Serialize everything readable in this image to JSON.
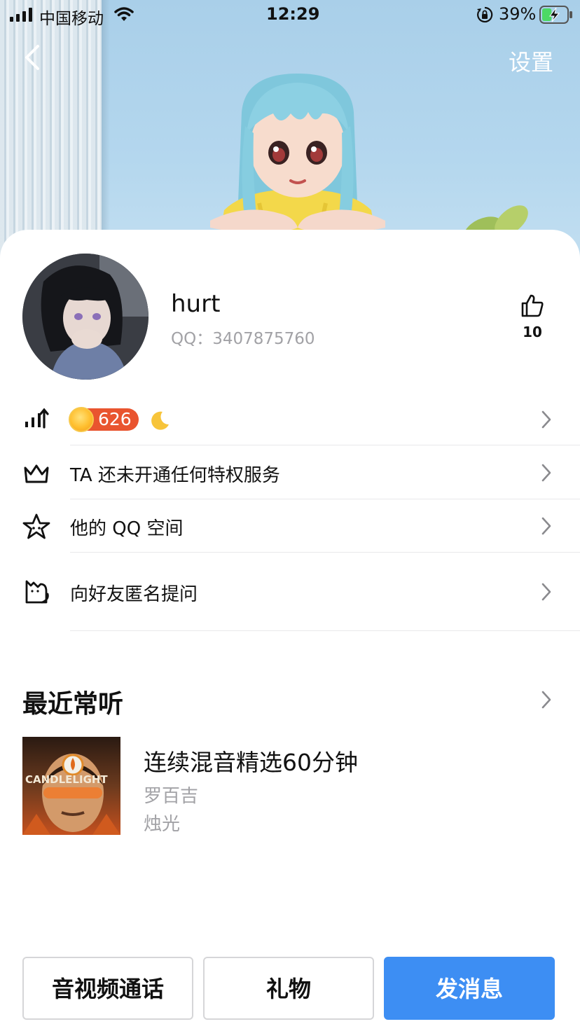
{
  "status_bar": {
    "carrier": "中国移动",
    "time": "12:29",
    "battery_percent": "39%",
    "battery_level": 0.39,
    "icons": [
      "signal-icon",
      "wifi-icon",
      "orientation-lock-icon",
      "battery-charging-icon"
    ]
  },
  "nav": {
    "back_icon": "chevron-left-icon",
    "settings_label": "设置"
  },
  "profile": {
    "nickname": "hurt",
    "qq_text": "QQ：3407875760",
    "like_count": "10",
    "like_icon": "thumbs-up-icon"
  },
  "rows": {
    "level": {
      "icon": "level-up-icon",
      "level_value": "626",
      "extra_icon": "moon-icon"
    },
    "privilege": {
      "icon": "crown-icon",
      "label": "TA 还未开通任何特权服务"
    },
    "qzone": {
      "icon": "star-icon",
      "label": "他的 QQ 空间"
    },
    "anon_question": {
      "icon": "cat-box-icon",
      "label": "向好友匿名提问"
    }
  },
  "music": {
    "section_title": "最近常听",
    "song_name": "连续混音精选60分钟",
    "artist": "罗百吉",
    "album": "烛光",
    "cover_text": "CANDLELIGHT"
  },
  "actions": {
    "call_label": "音视频通话",
    "gift_label": "礼物",
    "message_label": "发消息"
  },
  "colors": {
    "accent_blue": "#3d8ef3",
    "level_badge": "#e9542f",
    "secondary_text": "#a2a2a6",
    "hero_bg": "#b4d7ee"
  }
}
